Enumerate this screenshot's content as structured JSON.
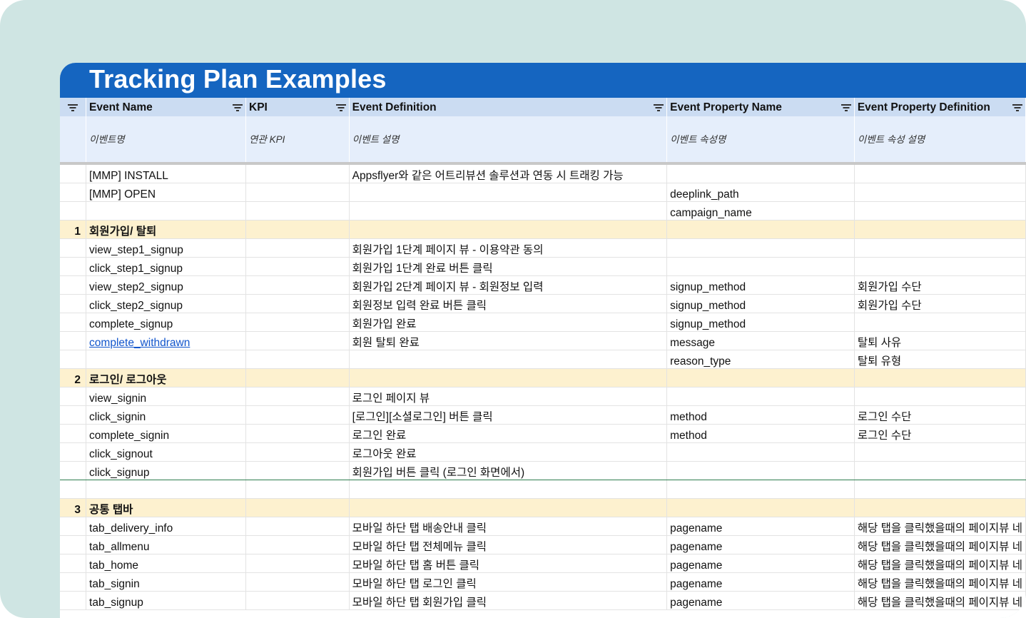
{
  "title": "Tracking Plan Examples",
  "headers": [
    "Event Name",
    "KPI",
    "Event Definition",
    "Event Property Name",
    "Event Property Definition"
  ],
  "subheaders": [
    "이벤트명",
    "연관 KPI",
    "이벤트 설명",
    "이벤트 속성명",
    "이벤트 속성 설명"
  ],
  "rows": [
    {
      "num": "",
      "event": "[MMP] INSTALL",
      "kpi": "",
      "def": "Appsflyer와 같은 어트리뷰션 솔루션과 연동 시 트래킹 가능",
      "prop": "",
      "propdef": ""
    },
    {
      "num": "",
      "event": "[MMP] OPEN",
      "kpi": "",
      "def": "",
      "prop": "deeplink_path",
      "propdef": ""
    },
    {
      "num": "",
      "event": "",
      "kpi": "",
      "def": "",
      "prop": "campaign_name",
      "propdef": ""
    },
    {
      "num": "1",
      "event": "회원가입/ 탈퇴",
      "kpi": "",
      "def": "",
      "prop": "",
      "propdef": "",
      "section": true
    },
    {
      "num": "",
      "event": "view_step1_signup",
      "kpi": "",
      "def": "회원가입 1단계 페이지 뷰 - 이용약관 동의",
      "prop": "",
      "propdef": ""
    },
    {
      "num": "",
      "event": "click_step1_signup",
      "kpi": "",
      "def": "회원가입 1단계 완료 버튼 클릭",
      "prop": "",
      "propdef": ""
    },
    {
      "num": "",
      "event": "view_step2_signup",
      "kpi": "",
      "def": "회원가입 2단계 페이지 뷰 - 회원정보 입력",
      "prop": "signup_method",
      "propdef": "회원가입 수단"
    },
    {
      "num": "",
      "event": "click_step2_signup",
      "kpi": "",
      "def": "회원정보 입력 완료 버튼 클릭",
      "prop": "signup_method",
      "propdef": "회원가입 수단"
    },
    {
      "num": "",
      "event": "complete_signup",
      "kpi": "",
      "def": "회원가입 완료",
      "prop": "signup_method",
      "propdef": ""
    },
    {
      "num": "",
      "event": "complete_withdrawn",
      "kpi": "",
      "def": "회원 탈퇴 완료",
      "prop": "message",
      "propdef": "탈퇴 사유",
      "link": true
    },
    {
      "num": "",
      "event": "",
      "kpi": "",
      "def": "",
      "prop": "reason_type",
      "propdef": "탈퇴 유형"
    },
    {
      "num": "2",
      "event": "로그인/ 로그아웃",
      "kpi": "",
      "def": "",
      "prop": "",
      "propdef": "",
      "section": true
    },
    {
      "num": "",
      "event": "view_signin",
      "kpi": "",
      "def": "로그인 페이지 뷰",
      "prop": "",
      "propdef": ""
    },
    {
      "num": "",
      "event": "click_signin",
      "kpi": "",
      "def": "[로그인][소셜로그인] 버튼 클릭",
      "prop": "method",
      "propdef": "로그인 수단"
    },
    {
      "num": "",
      "event": "complete_signin",
      "kpi": "",
      "def": "로그인 완료",
      "prop": "method",
      "propdef": "로그인 수단"
    },
    {
      "num": "",
      "event": "click_signout",
      "kpi": "",
      "def": "로그아웃 완료",
      "prop": "",
      "propdef": ""
    },
    {
      "num": "",
      "event": "click_signup",
      "kpi": "",
      "def": "회원가입 버튼 클릭 (로그인 화면에서)",
      "prop": "",
      "propdef": "",
      "green": true
    },
    {
      "num": "",
      "event": "",
      "kpi": "",
      "def": "",
      "prop": "",
      "propdef": ""
    },
    {
      "num": "3",
      "event": "공통 탭바",
      "kpi": "",
      "def": "",
      "prop": "",
      "propdef": "",
      "section": true
    },
    {
      "num": "",
      "event": "tab_delivery_info",
      "kpi": "",
      "def": "모바일 하단 탭 배송안내 클릭",
      "prop": "pagename",
      "propdef": "해당 탭을 클릭했을때의 페이지뷰 네"
    },
    {
      "num": "",
      "event": "tab_allmenu",
      "kpi": "",
      "def": "모바일 하단 탭 전체메뉴 클릭",
      "prop": "pagename",
      "propdef": "해당 탭을 클릭했을때의 페이지뷰 네"
    },
    {
      "num": "",
      "event": "tab_home",
      "kpi": "",
      "def": "모바일 하단 탭 홈 버튼 클릭",
      "prop": "pagename",
      "propdef": "해당 탭을 클릭했을때의 페이지뷰 네"
    },
    {
      "num": "",
      "event": "tab_signin",
      "kpi": "",
      "def": "모바일 하단 탭 로그인 클릭",
      "prop": "pagename",
      "propdef": "해당 탭을 클릭했을때의 페이지뷰 네"
    },
    {
      "num": "",
      "event": "tab_signup",
      "kpi": "",
      "def": "모바일 하단 탭 회원가입 클릭",
      "prop": "pagename",
      "propdef": "해당 탭을 클릭했을때의 페이지뷰 네"
    }
  ],
  "colors": {
    "title_bg": "#1565c0",
    "header_bg": "#cbdcf2",
    "section_bg": "#fdf1cf",
    "frame_bg": "#cfe5e3",
    "link": "#1155cc"
  }
}
